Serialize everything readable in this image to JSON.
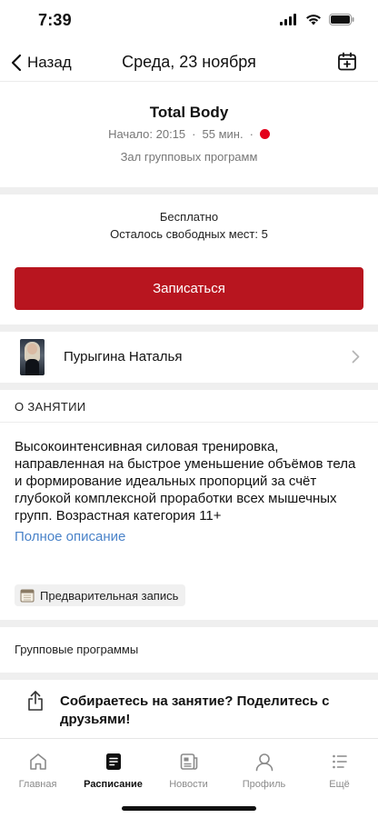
{
  "status_bar": {
    "time": "7:39"
  },
  "nav": {
    "back_label": "Назад",
    "title": "Среда, 23 ноября"
  },
  "class_info": {
    "title": "Total Body",
    "start": "Начало: 20:15",
    "separator": "·",
    "duration": "55 мин.",
    "room": "Зал групповых программ",
    "live_color": "#e3001b"
  },
  "availability": {
    "price": "Бесплатно",
    "seats": "Осталось свободных мест: 5"
  },
  "signup": {
    "label": "Записаться",
    "color": "#b8151f"
  },
  "trainer": {
    "name": "Пурыгина Наталья"
  },
  "about": {
    "section_label": "О ЗАНЯТИИ",
    "description": "Высокоинтенсивная силовая тренировка, направленная на быстрое уменьшение объёмов тела и формирование идеальных пропорций за счёт глубокой комплексной проработки всех мышечных групп. Возрастная категория 11+",
    "full_link": "Полное описание",
    "link_color": "#4a83c9"
  },
  "tag": {
    "icon": "calendar-emoji-icon",
    "label": "Предварительная запись"
  },
  "category": {
    "label": "Групповые программы"
  },
  "share": {
    "text": "Собираетесь на занятие? Поделитесь с друзьями!"
  },
  "tabs": [
    {
      "label": "Главная",
      "icon": "home-icon",
      "active": false
    },
    {
      "label": "Расписание",
      "icon": "schedule-icon",
      "active": true
    },
    {
      "label": "Новости",
      "icon": "news-icon",
      "active": false
    },
    {
      "label": "Профиль",
      "icon": "profile-icon",
      "active": false
    },
    {
      "label": "Ещё",
      "icon": "more-icon",
      "active": false
    }
  ]
}
